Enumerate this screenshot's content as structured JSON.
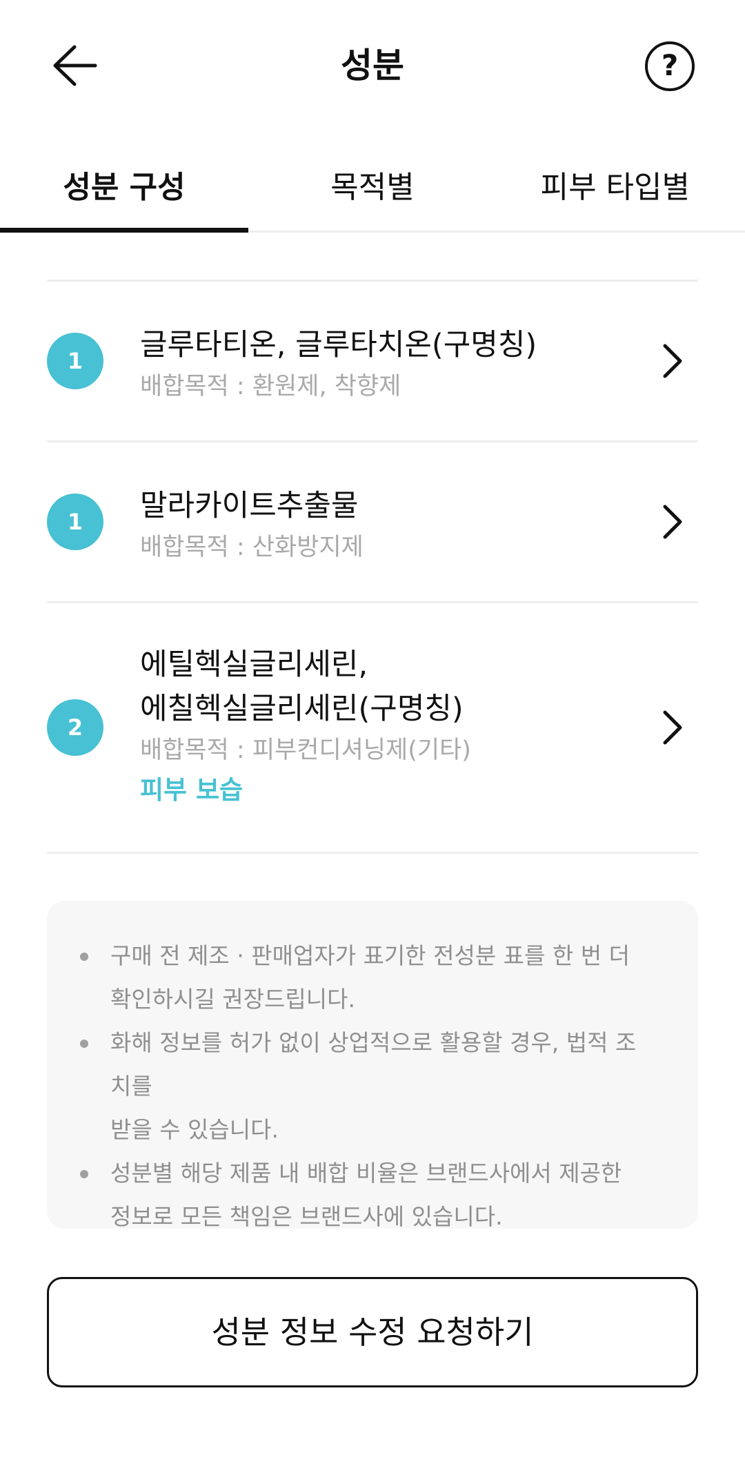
{
  "header": {
    "title": "성분",
    "help_icon": "question-circle-icon",
    "help_glyph": "?",
    "back_icon": "arrow-left-icon"
  },
  "tabs": [
    {
      "label": "성분 구성",
      "active": true
    },
    {
      "label": "목적별",
      "active": false
    },
    {
      "label": "피부 타입별",
      "active": false
    }
  ],
  "ingredients": [
    {
      "badge": "1",
      "name_lines": [
        "글루타티온, 글루타치온(구명칭)"
      ],
      "purpose": "배합목적 : 환원제, 착향제",
      "tag": ""
    },
    {
      "badge": "1",
      "name_lines": [
        "말라카이트추출물"
      ],
      "purpose": "배합목적 : 산화방지제",
      "tag": ""
    },
    {
      "badge": "2",
      "name_lines": [
        "에틸헥실글리세린,",
        "에칠헥실글리세린(구명칭)"
      ],
      "purpose": "배합목적 : 피부컨디셔닝제(기타)",
      "tag": "피부 보습"
    }
  ],
  "notices": [
    "구매 전 제조 · 판매업자가 표기한 전성분 표를 한 번 더\n확인하시길 권장드립니다.",
    "화해 정보를 허가 없이 상업적으로 활용할 경우, 법적 조치를\n받을 수 있습니다.",
    "성분별 해당 제품 내 배합 비율은 브랜드사에서 제공한\n정보로 모든 책임은 브랜드사에 있습니다."
  ],
  "edit_button_label": "성분 정보 수정 요청하기",
  "colors": {
    "accent": "#47c1d3",
    "muted_text": "#a9a9a9",
    "notice_bg": "#f7f7f7"
  }
}
